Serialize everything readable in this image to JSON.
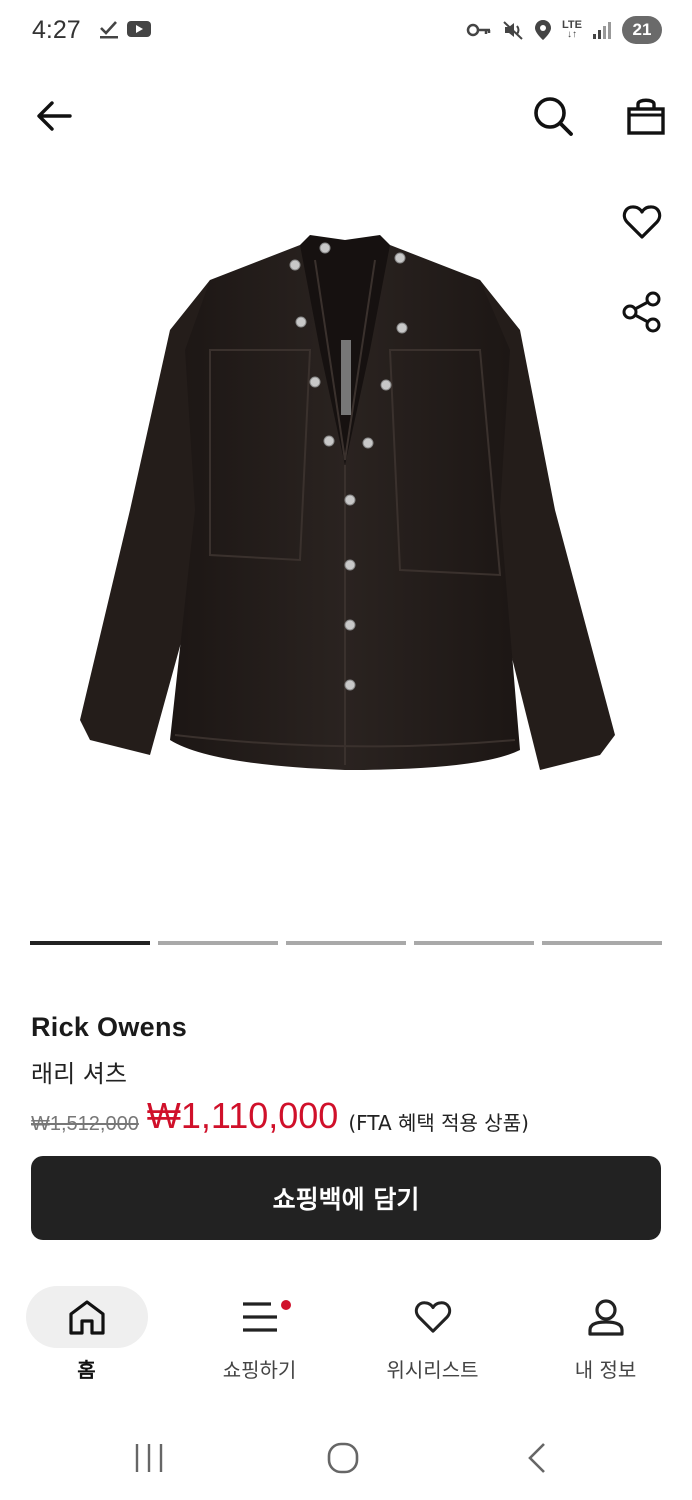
{
  "status": {
    "time": "4:27",
    "network": "LTE",
    "battery": "21",
    "icons": [
      "check-download-icon",
      "youtube-icon",
      "vpn-key-icon",
      "mute-icon",
      "location-icon",
      "signal-icon"
    ]
  },
  "header": {
    "icons": [
      "back-arrow-icon",
      "search-icon",
      "shopping-bag-icon"
    ]
  },
  "product": {
    "image_alt": "black-shirt-image",
    "brand": "Rick Owens",
    "name": "래리 셔츠",
    "price_original": "₩1,512,000",
    "price_sale": "₩1,110,000",
    "price_note": "(FTA 혜택 적용 상품)",
    "image_count": 5,
    "active_image_index": 0
  },
  "actions": {
    "wishlist_icon": "heart-icon",
    "share_icon": "share-icon",
    "add_to_bag": "쇼핑백에 담기"
  },
  "bottom_nav": {
    "items": [
      {
        "label": "홈",
        "icon": "home-icon",
        "active": true
      },
      {
        "label": "쇼핑하기",
        "icon": "menu-icon",
        "badge": true
      },
      {
        "label": "위시리스트",
        "icon": "heart-icon"
      },
      {
        "label": "내 정보",
        "icon": "person-icon"
      }
    ]
  },
  "colors": {
    "accent_red": "#d0102a",
    "cta_bg": "#222222",
    "text": "#1a1a1a"
  }
}
